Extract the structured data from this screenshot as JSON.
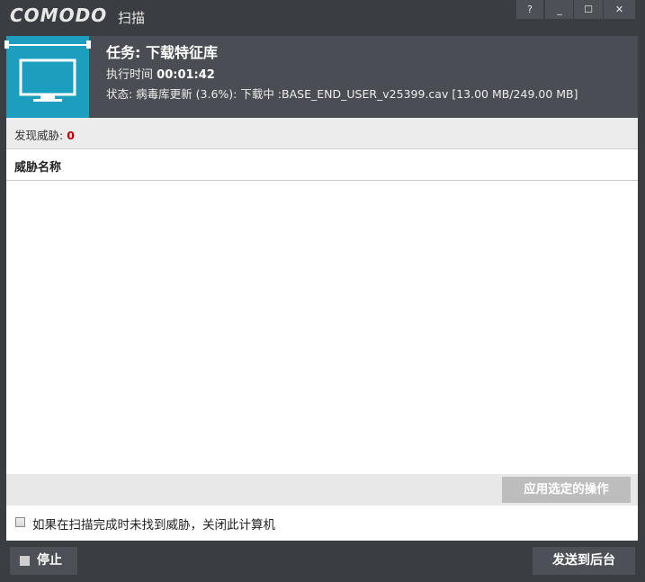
{
  "window": {
    "brand": "COMODO",
    "title": "扫描",
    "buttons": {
      "help": "?",
      "minimize": "_",
      "maximize": "☐",
      "close": "✕"
    }
  },
  "scan": {
    "task_label": "任务: 下载特征库",
    "exec_label": "执行时间",
    "exec_time": "00:01:42",
    "status": "状态: 病毒库更新 (3.6%): 下载中 :BASE_END_USER_v25399.cav [13.00 MB/249.00 MB]",
    "progress_percent": 3.6,
    "icon": "monitor-icon"
  },
  "threats": {
    "found_label": "发现威胁: ",
    "found_count": "0",
    "column_name": "威胁名称",
    "rows": []
  },
  "actions": {
    "apply_label": "应用选定的操作",
    "shutdown_label": "如果在扫描完成时未找到威胁，关闭此计算机",
    "shutdown_checked": false,
    "stop_label": "停止",
    "background_label": "发送到后台"
  },
  "colors": {
    "accent": "#1c9fbe",
    "threat_count": "#c00000",
    "chrome": "#3a3d42"
  }
}
